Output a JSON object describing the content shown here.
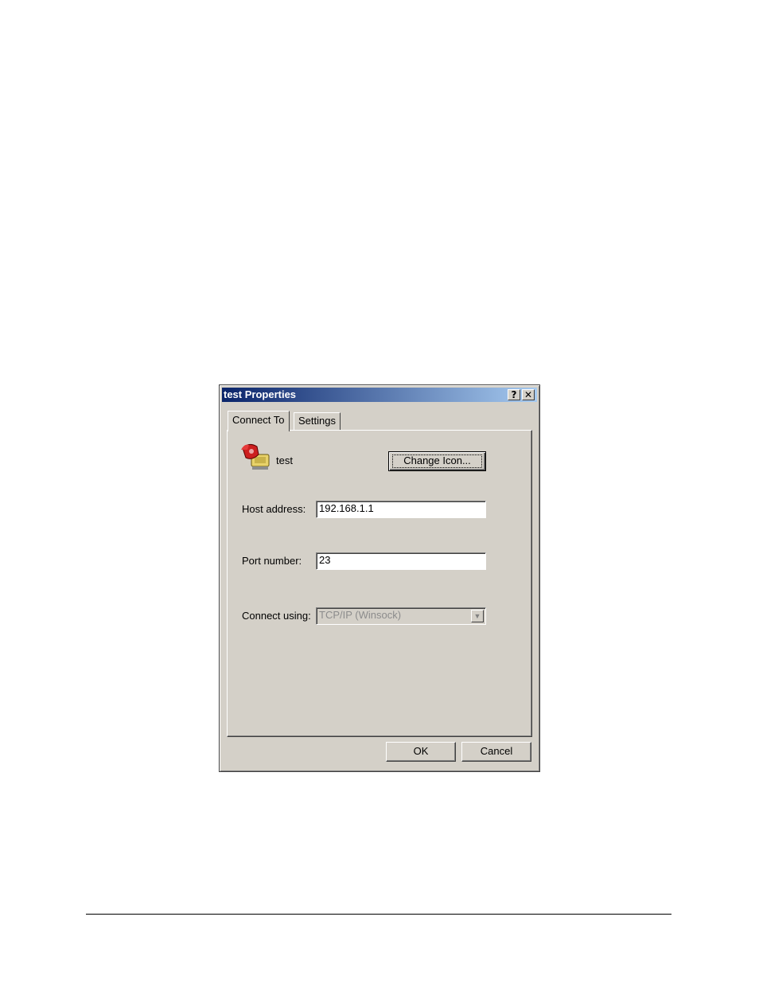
{
  "window": {
    "title": "test Properties",
    "help_button": "?",
    "close_button": "✕"
  },
  "tabs": [
    {
      "label": "Connect To",
      "active": true
    },
    {
      "label": "Settings",
      "active": false
    }
  ],
  "connection": {
    "icon": "telephone-icon",
    "name": "test",
    "change_icon_button": "Change Icon..."
  },
  "fields": {
    "host_label": "Host address:",
    "host_value": "192.168.1.1",
    "port_label": "Port number:",
    "port_value": "23",
    "connect_label": "Connect using:",
    "connect_value": "TCP/IP (Winsock)"
  },
  "buttons": {
    "ok": "OK",
    "cancel": "Cancel"
  },
  "colors": {
    "title_start": "#0a246a",
    "title_end": "#a6caf0",
    "face": "#d4d0c8"
  }
}
